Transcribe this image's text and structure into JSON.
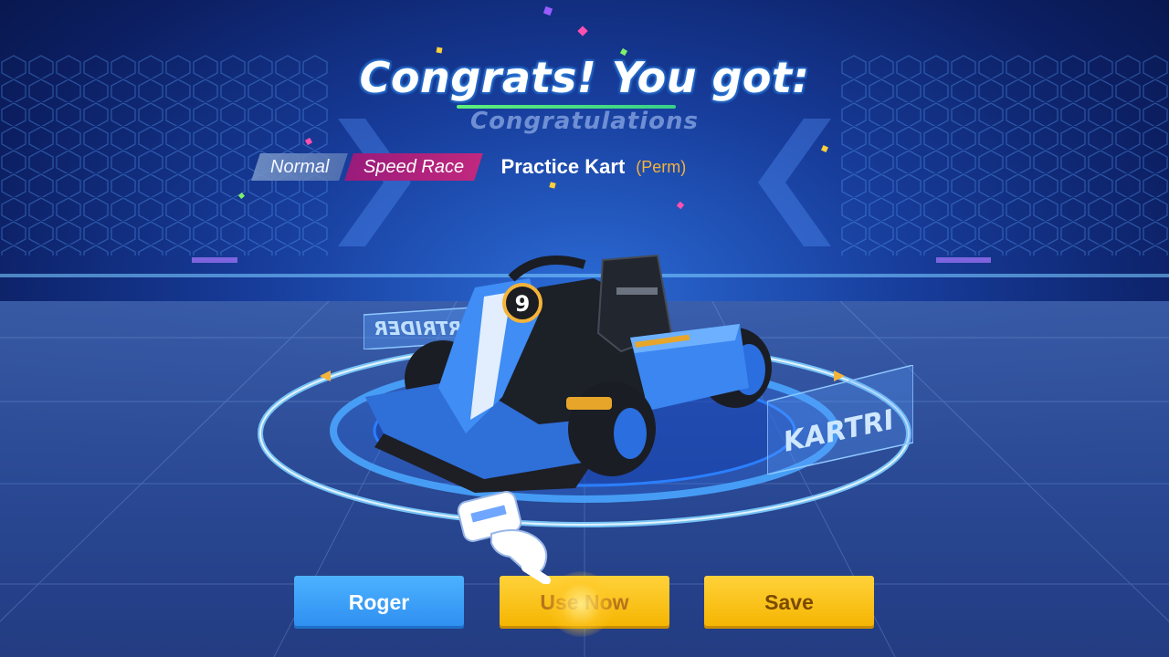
{
  "header": {
    "title": "Congrats! You got:",
    "subtitle": "Congratulations"
  },
  "reward": {
    "tags": [
      "Normal",
      "Speed Race"
    ],
    "name": "Practice Kart",
    "duration": "(Perm)"
  },
  "buttons": {
    "roger": "Roger",
    "use_now": "Use Now",
    "save": "Save"
  },
  "kart": {
    "number": "9"
  },
  "colors": {
    "accent_blue": "#2e8ef0",
    "accent_yellow": "#f5b400",
    "tag_speed": "#c0287e",
    "perm_orange": "#f5b33a"
  }
}
